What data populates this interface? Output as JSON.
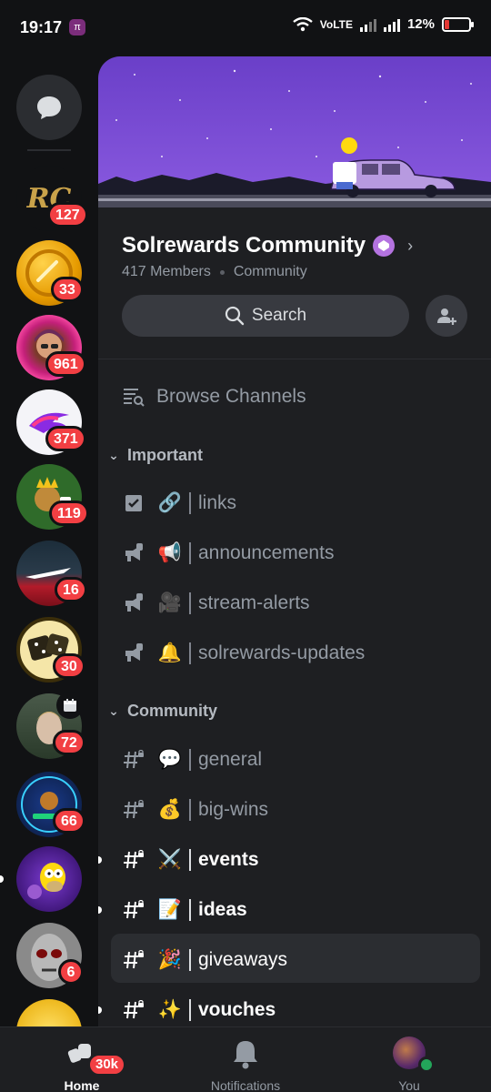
{
  "status_bar": {
    "time": "19:17",
    "pi_badge": "π",
    "network": "VoLTE",
    "battery": "12%"
  },
  "rail": {
    "dm_label": "Direct Messages",
    "servers": [
      {
        "name": "R C server",
        "icon_text": "RC",
        "badge": "127"
      },
      {
        "name": "gold coin server",
        "icon_text": "",
        "badge": "33"
      },
      {
        "name": "pink avatar server",
        "icon_text": "",
        "badge": "961"
      },
      {
        "name": "eagle server",
        "icon_text": "",
        "badge": "371"
      },
      {
        "name": "king server",
        "icon_text": "",
        "badge": "119"
      },
      {
        "name": "red logo server",
        "icon_text": "",
        "badge": "16"
      },
      {
        "name": "dice server",
        "icon_text": "",
        "badge": "30"
      },
      {
        "name": "portrait server",
        "icon_text": "",
        "badge": "72"
      },
      {
        "name": "neon server",
        "icon_text": "",
        "badge": "66"
      },
      {
        "name": "homer server",
        "icon_text": "",
        "badge": ""
      },
      {
        "name": "mask server",
        "icon_text": "",
        "badge": "6"
      }
    ]
  },
  "server": {
    "name": "Solrewards Community",
    "members": "417 Members",
    "type": "Community",
    "search_label": "Search",
    "browse_channels": "Browse Channels"
  },
  "categories": [
    {
      "name": "Important",
      "channels": [
        {
          "name": "links",
          "emoji": "🔗",
          "kind": "rules"
        },
        {
          "name": "announcements",
          "emoji": "📢",
          "kind": "announce"
        },
        {
          "name": "stream-alerts",
          "emoji": "🎥",
          "kind": "announce"
        },
        {
          "name": "solrewards-updates",
          "emoji": "🔔",
          "kind": "announce"
        }
      ]
    },
    {
      "name": "Community",
      "channels": [
        {
          "name": "general",
          "emoji": "💬",
          "kind": "text"
        },
        {
          "name": "big-wins",
          "emoji": "💰",
          "kind": "text"
        },
        {
          "name": "events",
          "emoji": "⚔️",
          "kind": "text",
          "unread": true
        },
        {
          "name": "ideas",
          "emoji": "📝",
          "kind": "text",
          "unread": true
        },
        {
          "name": "giveaways",
          "emoji": "🎉",
          "kind": "text",
          "selected": true
        },
        {
          "name": "vouches",
          "emoji": "✨",
          "kind": "text",
          "unread": true
        }
      ]
    }
  ],
  "bottom_nav": {
    "home": "Home",
    "home_badge": "30k",
    "notifications": "Notifications",
    "you": "You"
  },
  "colors": {
    "accent_red": "#f23f43",
    "boost_purple": "#b473e0",
    "banner_sky": "#7b4fd0",
    "online_green": "#23a55a"
  }
}
